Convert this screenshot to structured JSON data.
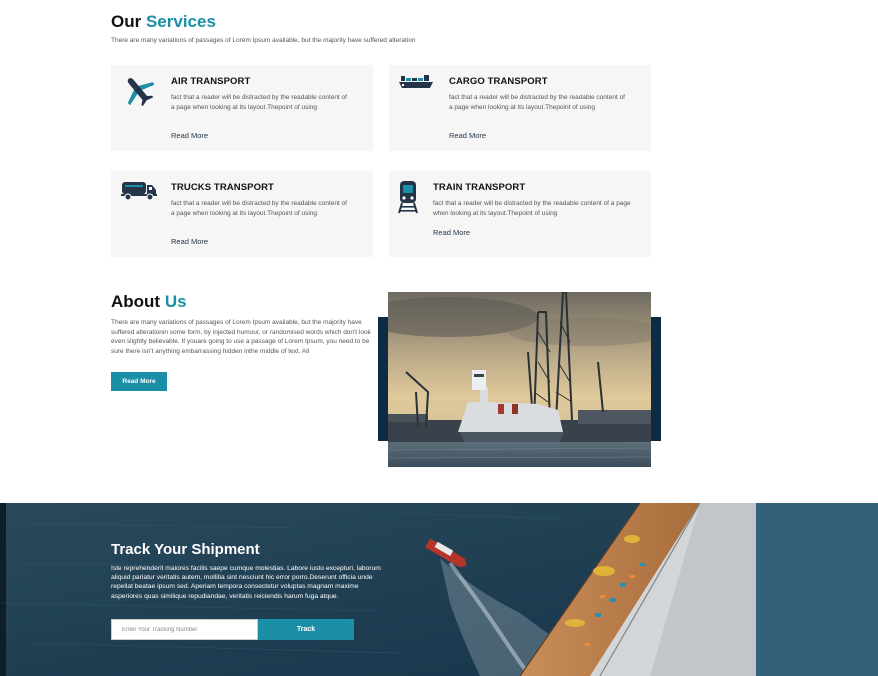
{
  "services": {
    "title_prefix": "Our",
    "title_accent": "Services",
    "subtitle": "There are many variations of passages of Lorem Ipsum available, but the majority have suffered alteration",
    "cards": [
      {
        "title": "AIR TRANSPORT",
        "icon": "airplane-icon",
        "description": "fact that a reader will be distracted by the readable content of a page when looking at its layout.Thepoint of using",
        "link": "Read More"
      },
      {
        "title": "CARGO TRANSPORT",
        "icon": "cargo-ship-icon",
        "description": "fact that a reader will be distracted by the readable content of a page when looking at its layout.Thepoint of using",
        "link": "Read More"
      },
      {
        "title": "TRUCKS TRANSPORT",
        "icon": "truck-icon",
        "description": "fact that a reader will be distracted by the readable content of a page when looking at its layout.Thepoint of using",
        "link": "Read More"
      },
      {
        "title": "TRAIN TRANSPORT",
        "icon": "train-icon",
        "description": "fact that a reader will be distracted by the readable content of a page when looking at its layout.Thepoint of using",
        "link": "Read More"
      }
    ]
  },
  "about": {
    "title_prefix": "About",
    "title_accent": "Us",
    "text": "There are many variations of passages of Lorem Ipsum available, but the majority have suffered alterationin some form, by injected humour, or randomised words which don't look even slightly believable. If youare going to use a passage of Lorem Ipsum, you need to be sure there isn't anything embarrassing hidden inthe middle of text. All",
    "button": "Read More"
  },
  "track": {
    "title": "Track Your Shipment",
    "text": "Iste reprehenderit maiores facilis saepe cumque molestias. Labore iusto excepturi, laborum aliquid pariatur veritatis autem, mollitia sint nesciunt hic error porro.Deserunt officia unde repellat beatae ipsum sed. Aperiam tempora consectetur voluptas magnam maxime asperiores quas similique repudiandae, veritatis reiciendis harum fuga atque.",
    "input_placeholder": "Enter Your Tracking Number",
    "button": "Track"
  },
  "colors": {
    "accent": "#1a8fa6",
    "dark_navy": "#0f2b44",
    "card_bg": "#f6f6f6"
  }
}
